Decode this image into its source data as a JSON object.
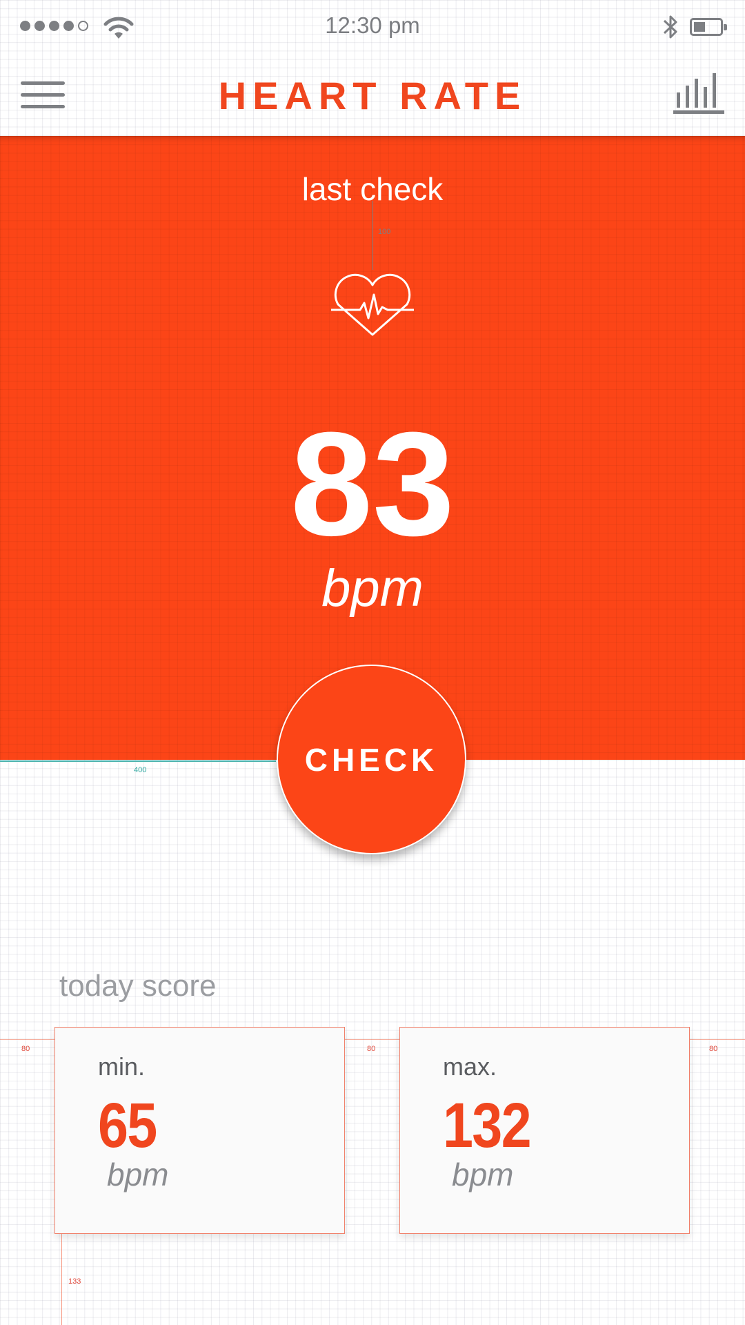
{
  "status_bar": {
    "time": "12:30 pm",
    "signal_bars_filled": 4,
    "signal_bars_total": 5,
    "icons": [
      "signal-dots-icon",
      "wifi-icon",
      "bluetooth-icon",
      "battery-icon"
    ],
    "battery_level": 0.35
  },
  "header": {
    "title": "HEART RATE",
    "menu_icon": "hamburger-menu-icon",
    "chart_icon": "bar-chart-icon"
  },
  "hero": {
    "label": "last check",
    "heart_icon": "heart-pulse-icon",
    "guide_value": "100",
    "bpm_value": "83",
    "bpm_unit": "bpm",
    "background_color": "#fc4517"
  },
  "guides": {
    "teal_label": "400",
    "red_labels": [
      "80",
      "80",
      "80"
    ],
    "vertical_label": "133"
  },
  "check_button": {
    "label": "CHECK"
  },
  "today_score": {
    "heading": "today score",
    "cards": [
      {
        "label": "min.",
        "value": "65",
        "unit": "bpm"
      },
      {
        "label": "max.",
        "value": "132",
        "unit": "bpm"
      }
    ]
  },
  "colors": {
    "accent": "#f0461e",
    "hero": "#fc4517",
    "icon_gray": "#7d7f83",
    "text_gray": "#9b9da1"
  }
}
